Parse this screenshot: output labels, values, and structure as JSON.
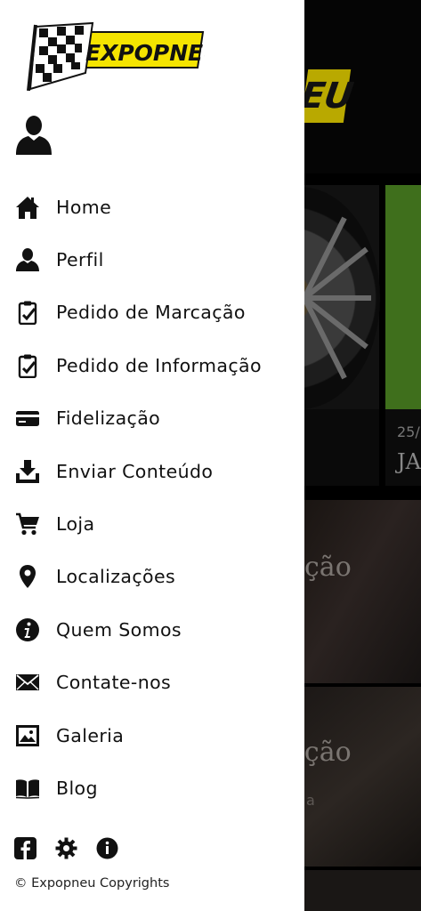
{
  "drawer": {
    "logo_text": "EXPOPNEU",
    "menu": [
      {
        "label": "Home",
        "icon": "home-icon"
      },
      {
        "label": "Perfil",
        "icon": "person-icon"
      },
      {
        "label": "Pedido de Marcação",
        "icon": "clipboard-check-icon"
      },
      {
        "label": "Pedido de Informação",
        "icon": "clipboard-check-icon"
      },
      {
        "label": "Fidelização",
        "icon": "credit-card-icon"
      },
      {
        "label": "Enviar Conteúdo",
        "icon": "download-tray-icon"
      },
      {
        "label": "Loja",
        "icon": "shopping-cart-icon"
      },
      {
        "label": "Localizações",
        "icon": "location-pin-icon"
      },
      {
        "label": "Quem Somos",
        "icon": "info-icon"
      },
      {
        "label": "Contate-nos",
        "icon": "envelope-icon"
      },
      {
        "label": "Galeria",
        "icon": "image-icon"
      },
      {
        "label": "Blog",
        "icon": "open-book-icon"
      }
    ],
    "footer_icons": [
      "facebook-icon",
      "gear-icon",
      "info-icon"
    ],
    "copyright": "© Expopneu Copyrights"
  },
  "background": {
    "logo_fragment": "EU",
    "card_date": "25/",
    "card_title": "JA",
    "section1_text": "ção",
    "section2_text": "ação",
    "section2_sub": "a"
  },
  "colors": {
    "brand_yellow": "#f5e400",
    "drawer_bg": "#ffffff",
    "icon": "#111111"
  }
}
